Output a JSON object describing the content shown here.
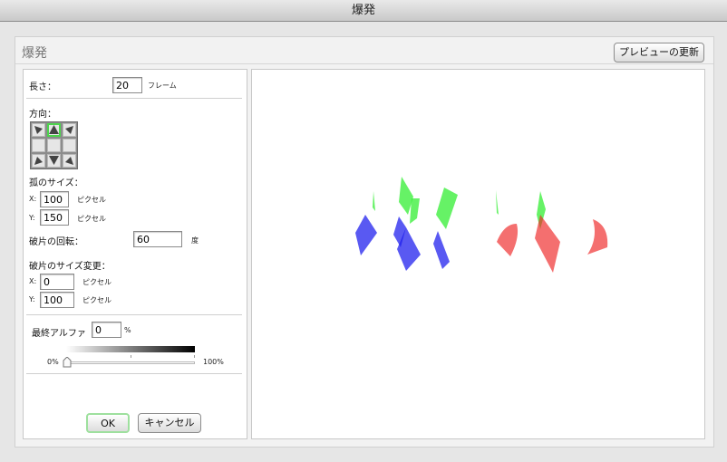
{
  "window": {
    "title": "爆発"
  },
  "dialog": {
    "title": "爆発",
    "preview_button": "プレビューの更新",
    "ok_button": "OK",
    "cancel_button": "キャンセル"
  },
  "settings": {
    "length": {
      "label": "長さ：",
      "value": "20",
      "unit": "フレーム"
    },
    "direction": {
      "label": "方向：",
      "selected": "up",
      "cells": [
        "up-left-arrow",
        "up-arrow",
        "up-right-arrow",
        "left-empty",
        "center-empty",
        "right-empty",
        "down-left-arrow",
        "down-arrow",
        "down-right-arrow"
      ]
    },
    "arc_size": {
      "label": "孤のサイズ：",
      "x_label": "X:",
      "x_value": "100",
      "y_label": "Y:",
      "y_value": "150",
      "unit": "ピクセル"
    },
    "rotation": {
      "label": "破片の回転：",
      "value": "60",
      "unit": "度"
    },
    "resize": {
      "label": "破片のサイズ変更：",
      "x_label": "X:",
      "x_value": "0",
      "y_label": "Y:",
      "y_value": "100",
      "unit": "ピクセル"
    },
    "final_alpha": {
      "label": "最終アルファ",
      "value": "0",
      "unit": "%",
      "slider_min": "0%",
      "slider_max": "100%",
      "slider_level": 0
    }
  },
  "preview": {
    "colors": {
      "green": "#33ee33",
      "blue": "#2222ee",
      "red": "#ee2222"
    }
  }
}
